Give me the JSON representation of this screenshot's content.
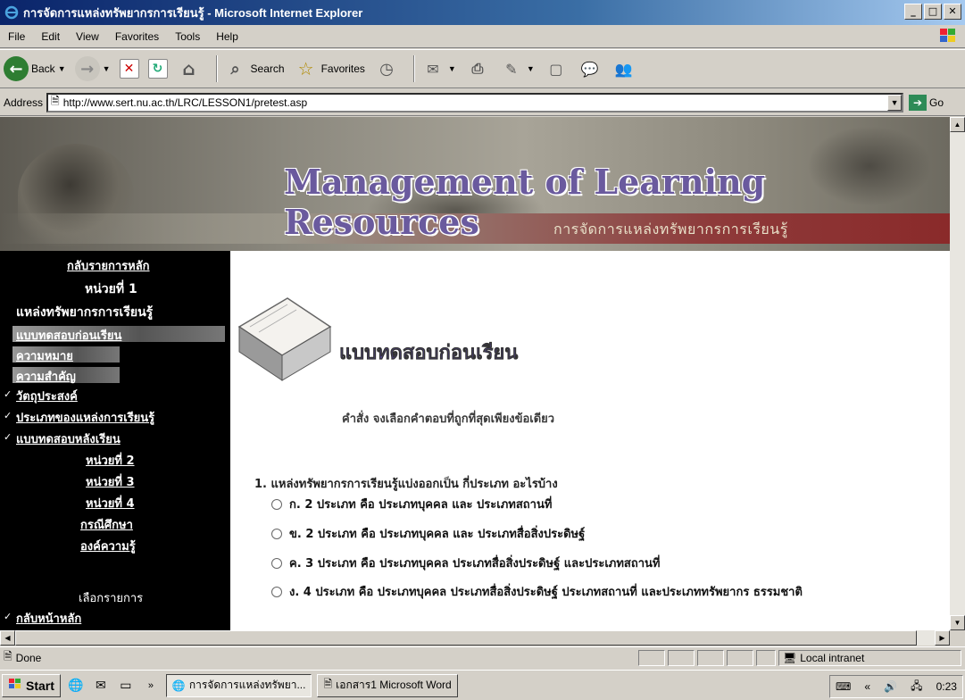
{
  "window": {
    "title": "การจัดการแหล่งทรัพยากรการเรียนรู้ - Microsoft Internet Explorer",
    "buttons": [
      "_",
      "□",
      "✕"
    ]
  },
  "menu": [
    "File",
    "Edit",
    "View",
    "Favorites",
    "Tools",
    "Help"
  ],
  "toolbar": {
    "back": "Back",
    "search": "Search",
    "favorites": "Favorites"
  },
  "address": {
    "label": "Address",
    "url": "http://www.sert.nu.ac.th/LRC/LESSON1/pretest.asp",
    "go": "Go"
  },
  "banner": {
    "title": "Management of Learning Resources",
    "subtitle": "การจัดการแหล่งทรัพยากรการเรียนรู้"
  },
  "sidebar": {
    "back_main": "กลับรายการหลัก",
    "unit1": "หน่วยที่ 1",
    "unit1_title": "แหล่งทรัพยากรการเรียนรู้",
    "item_pretest": "แบบทดสอบก่อนเรียน",
    "item_meaning": "ความหมาย",
    "item_importance": "ความสำคัญ",
    "item_objective": "วัตถุประสงค์",
    "item_types": "ประเภทของแหล่งการเรียนรู้",
    "item_posttest": "แบบทดสอบหลังเรียน",
    "unit2": "หน่วยที่ 2",
    "unit3": "หน่วยที่ 3",
    "unit4": "หน่วยที่ 4",
    "case_study": "กรณีศึกษา",
    "knowledge": "องค์ความรู้",
    "choose": "เลือกรายการ",
    "home": "กลับหน้าหลัก"
  },
  "main": {
    "title": "แบบทดสอบก่อนเรียน",
    "instruction": "คำสั่ง จงเลือกคำตอบที่ถูกที่สุดเพียงข้อเดียว",
    "question": "1. แหล่งทรัพยากรการเรียนรู้แบ่งออกเป็น กี่ประเภท อะไรบ้าง",
    "options": [
      "ก.  2 ประเภท คือ ประเภทบุคคล และ ประเภทสถานที่",
      "ข.  2 ประเภท คือ ประเภทบุคคล และ ประเภทสื่อสิ่งประดิษฐ์",
      "ค.  3 ประเภท คือ ประเภทบุคคล ประเภทสื่อสิ่งประดิษฐ์ และประเภทสถานที่",
      "ง.  4 ประเภท คือ ประเภทบุคคล ประเภทสื่อสิ่งประดิษฐ์ ประเภทสถานที่ และประเภททรัพยากร ธรรมชาติ"
    ]
  },
  "status": {
    "text": "Done",
    "zone": "Local intranet"
  },
  "taskbar": {
    "start": "Start",
    "task1": "การจัดการแหล่งทรัพยา...",
    "task2": "เอกสาร1  Microsoft Word",
    "clock": "0:23"
  }
}
